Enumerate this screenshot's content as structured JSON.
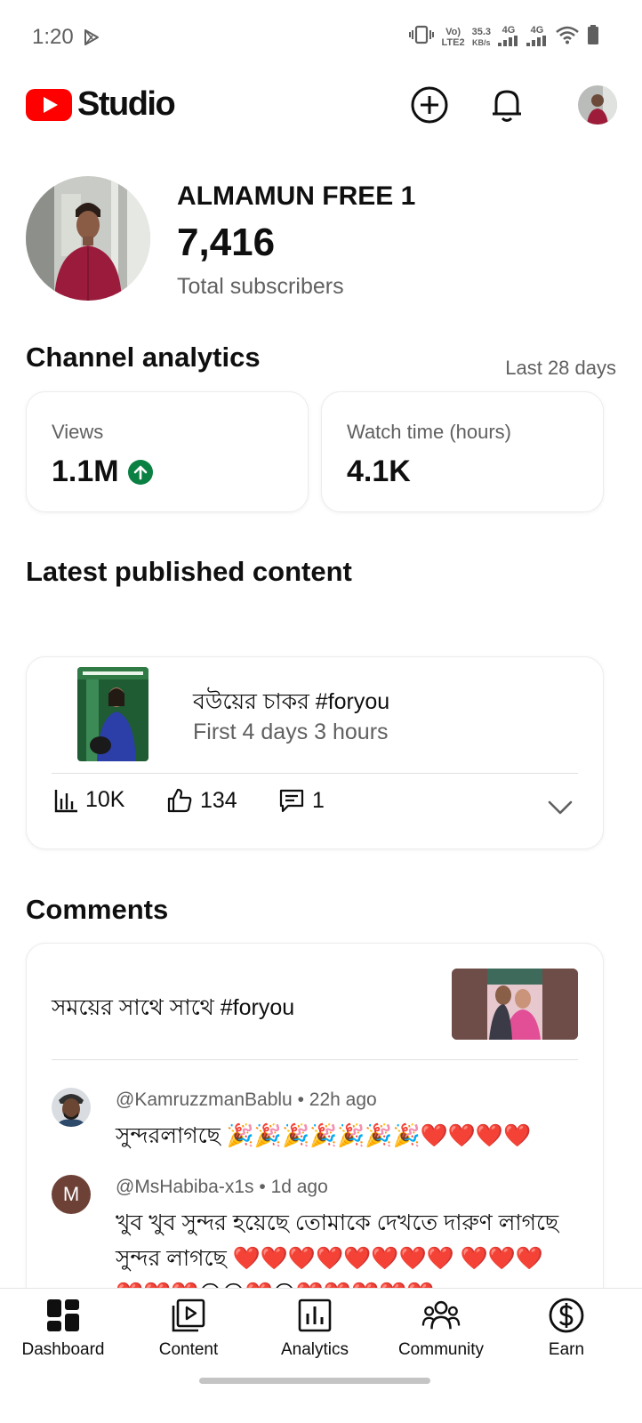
{
  "status_bar": {
    "time": "1:20",
    "volte": "Vo)",
    "lte": "LTE2",
    "speed_value": "35.3",
    "speed_unit": "KB/s",
    "net1": "4G",
    "net2": "4G"
  },
  "app_bar": {
    "logo_text": "Studio"
  },
  "channel": {
    "name": "ALMAMUN FREE 1",
    "subscribers": "7,416",
    "subscribers_label": "Total subscribers"
  },
  "analytics": {
    "title": "Channel analytics",
    "range": "Last 28 days",
    "views_label": "Views",
    "views_value": "1.1M",
    "watch_label": "Watch time (hours)",
    "watch_value": "4.1K"
  },
  "latest": {
    "title": "Latest published content",
    "video_title": "বউয়ের চাকর #foryou",
    "video_age": "First 4 days 3 hours",
    "views": "10K",
    "likes": "134",
    "comments": "1"
  },
  "comments": {
    "title": "Comments",
    "post_title": "সময়ের সাথে  সাথে  #foryou",
    "items": [
      {
        "author": "@KamruzzmanBablu",
        "time": "22h ago",
        "text": "সুন্দরলাগছে 🎉🎉🎉🎉🎉🎉🎉❤️❤️❤️❤️"
      },
      {
        "author": "@MsHabiba-x1s",
        "time": "1d ago",
        "avatar_letter": "M",
        "text": "খুব খুব সুন্দর হয়েছে তোমাকে দেখতে দারুণ লাগছে সুন্দর লাগছে ❤️❤️❤️❤️❤️❤️❤️❤️ ❤️❤️❤️❤️❤️❤️😥😥❤️😥❤️❤️❤️❤️❤️"
      }
    ]
  },
  "nav": {
    "dashboard": "Dashboard",
    "content": "Content",
    "analytics": "Analytics",
    "community": "Community",
    "earn": "Earn"
  },
  "colors": {
    "brand_red": "#ff0000",
    "positive_green": "#0b8043",
    "secondary_text": "#606060"
  }
}
